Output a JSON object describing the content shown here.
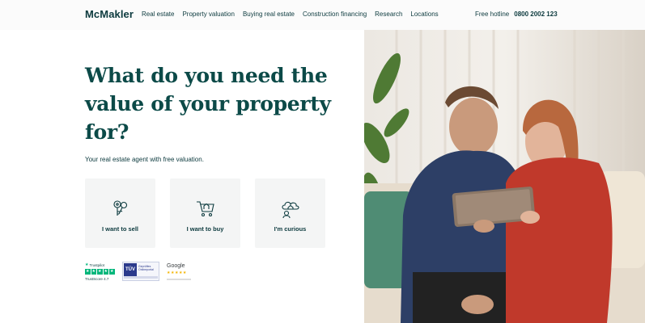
{
  "header": {
    "logo": "McMakler",
    "nav": [
      {
        "label": "Real estate"
      },
      {
        "label": "Property valuation"
      },
      {
        "label": "Buying real estate"
      },
      {
        "label": "Construction financing"
      },
      {
        "label": "Research"
      },
      {
        "label": "Locations"
      }
    ],
    "hotline_label": "Free hotline",
    "hotline_number": "0800 2002 123"
  },
  "hero": {
    "headline": "What do you need the value of your property for?",
    "subline": "Your real estate agent with free valuation.",
    "options": [
      {
        "label": "I want to sell",
        "icon": "keys-icon"
      },
      {
        "label": "I want to buy",
        "icon": "house-cart-icon"
      },
      {
        "label": "I'm curious",
        "icon": "cloud-thought-icon"
      }
    ]
  },
  "trust": {
    "trustpilot_brand": "Trustpilot",
    "trustpilot_score": "TrustScore 4.7",
    "tuv_mark": "TÜV",
    "tuv_text": "Geprüftes Onlineportal",
    "google_brand": "Google",
    "google_stars": "★★★★★"
  },
  "colors": {
    "brand": "#0c3a3e",
    "headline": "#0c4a48",
    "trustpilot_green": "#00b67a",
    "card_bg": "#f4f5f5"
  }
}
